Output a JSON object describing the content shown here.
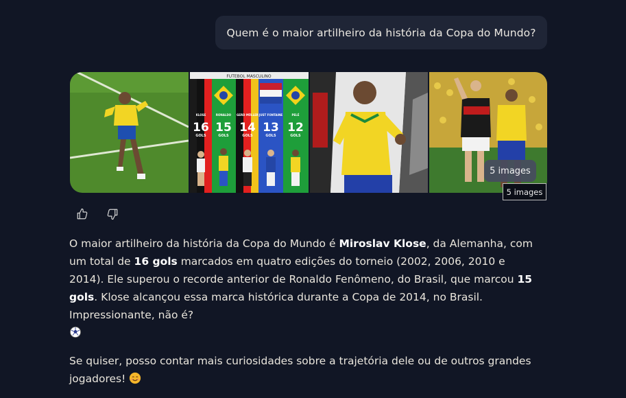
{
  "user_message": "Quem é o maior artilheiro da história da Copa do Mundo?",
  "images": {
    "count_label": "5 images",
    "tooltip": "5 images",
    "cards": [
      {
        "name": "ronaldo-celebrating"
      },
      {
        "name": "top-scorers-infographic",
        "header": "FUTEBOL MASCULINO",
        "columns": [
          {
            "player": "KLOSE",
            "goals": "16",
            "unit": "GOLS",
            "flag": "germany"
          },
          {
            "player": "RONALDO",
            "goals": "15",
            "unit": "GOLS",
            "flag": "brazil"
          },
          {
            "player": "GERD MÜLLER",
            "goals": "14",
            "unit": "GOLS",
            "flag": "germany"
          },
          {
            "player": "JUST FONTAINE",
            "goals": "13",
            "unit": "GOLS",
            "flag": "france"
          },
          {
            "player": "PELÉ",
            "goals": "12",
            "unit": "GOLS",
            "flag": "brazil"
          }
        ]
      },
      {
        "name": "ronaldo-running"
      },
      {
        "name": "klose-and-brazil-player"
      }
    ]
  },
  "colors": {
    "background": "#111625",
    "bubble": "#1f2536",
    "text": "#e9e5dc"
  },
  "feedback": {
    "like_icon": "thumbs-up-icon",
    "dislike_icon": "thumbs-down-icon"
  },
  "answer": {
    "p1": {
      "t1": "O maior artilheiro da história da Copa do Mundo é ",
      "b1": "Miroslav Klose",
      "t2": ", da Alemanha, com um total de ",
      "b2": "16 gols",
      "t3": " marcados em quatro edições do torneio (2002, 2006, 2010 e 2014). Ele superou o recorde anterior de Ronaldo Fenômeno, do Brasil, que marcou ",
      "b3": "15 gols",
      "t4": ". Klose alcançou essa marca histórica durante a Copa de 2014, no Brasil. Impressionante, não é?",
      "emoji": "soccer-ball-emoji"
    },
    "p2": {
      "t1": "Se quiser, posso contar mais curiosidades sobre a trajetória dele ou de outros grandes jogadores!",
      "emoji": "smiling-face-emoji"
    }
  }
}
